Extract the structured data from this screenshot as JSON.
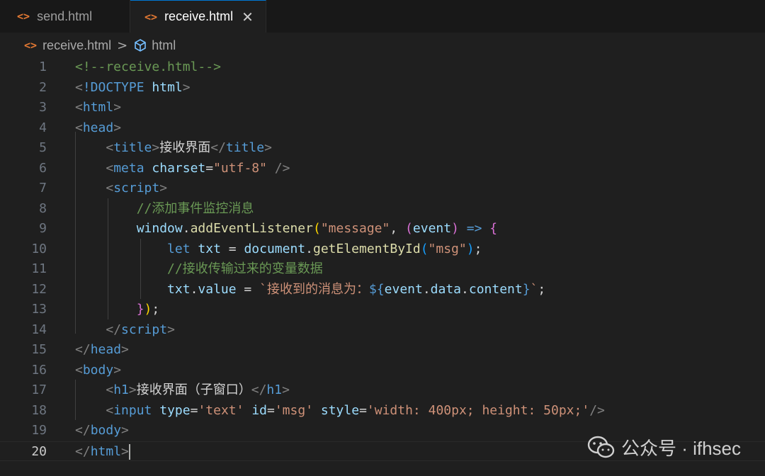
{
  "tabs": [
    {
      "label": "send.html",
      "icon": "html-file-icon"
    },
    {
      "label": "receive.html",
      "icon": "html-file-icon",
      "active": true
    }
  ],
  "tab_icon_glyph": "<>",
  "breadcrumb": {
    "file": "receive.html",
    "separator": ">",
    "symbol": "html"
  },
  "lines": [
    {
      "n": "1",
      "tokens": [
        [
          "c-cm",
          "<!--receive.html-->"
        ]
      ]
    },
    {
      "n": "2",
      "tokens": [
        [
          "c-br",
          "<"
        ],
        [
          "c-tag",
          "!DOCTYPE "
        ],
        [
          "c-attr",
          "html"
        ],
        [
          "c-br",
          ">"
        ]
      ]
    },
    {
      "n": "3",
      "tokens": [
        [
          "c-br",
          "<"
        ],
        [
          "c-tag",
          "html"
        ],
        [
          "c-br",
          ">"
        ]
      ]
    },
    {
      "n": "4",
      "tokens": [
        [
          "c-br",
          "<"
        ],
        [
          "c-tag",
          "head"
        ],
        [
          "c-br",
          ">"
        ]
      ]
    },
    {
      "n": "5",
      "tokens": [
        [
          "c-txt",
          "    "
        ],
        [
          "c-br",
          "<"
        ],
        [
          "c-tag",
          "title"
        ],
        [
          "c-br",
          ">"
        ],
        [
          "c-txt",
          "接收界面"
        ],
        [
          "c-br",
          "</"
        ],
        [
          "c-tag",
          "title"
        ],
        [
          "c-br",
          ">"
        ]
      ]
    },
    {
      "n": "6",
      "tokens": [
        [
          "c-txt",
          "    "
        ],
        [
          "c-br",
          "<"
        ],
        [
          "c-tag",
          "meta "
        ],
        [
          "c-attr",
          "charset"
        ],
        [
          "c-txt",
          "="
        ],
        [
          "c-str",
          "\"utf-8\""
        ],
        [
          "c-br",
          " />"
        ]
      ]
    },
    {
      "n": "7",
      "tokens": [
        [
          "c-txt",
          "    "
        ],
        [
          "c-br",
          "<"
        ],
        [
          "c-tag",
          "script"
        ],
        [
          "c-br",
          ">"
        ]
      ]
    },
    {
      "n": "8",
      "tokens": [
        [
          "c-txt",
          "        "
        ],
        [
          "c-cm",
          "//添加事件监控消息"
        ]
      ]
    },
    {
      "n": "9",
      "tokens": [
        [
          "c-txt",
          "        "
        ],
        [
          "c-var",
          "window"
        ],
        [
          "c-txt",
          "."
        ],
        [
          "c-fn",
          "addEventListener"
        ],
        [
          "c-b1",
          "("
        ],
        [
          "c-str",
          "\"message\""
        ],
        [
          "c-txt",
          ", "
        ],
        [
          "c-b2",
          "("
        ],
        [
          "c-var",
          "event"
        ],
        [
          "c-b2",
          ")"
        ],
        [
          "c-txt",
          " "
        ],
        [
          "c-kw",
          "=>"
        ],
        [
          "c-txt",
          " "
        ],
        [
          "c-b2",
          "{"
        ]
      ]
    },
    {
      "n": "10",
      "tokens": [
        [
          "c-txt",
          "            "
        ],
        [
          "c-kw",
          "let "
        ],
        [
          "c-var",
          "txt"
        ],
        [
          "c-txt",
          " = "
        ],
        [
          "c-var",
          "document"
        ],
        [
          "c-txt",
          "."
        ],
        [
          "c-fn",
          "getElementById"
        ],
        [
          "c-b3",
          "("
        ],
        [
          "c-str",
          "\"msg\""
        ],
        [
          "c-b3",
          ")"
        ],
        [
          "c-txt",
          ";"
        ]
      ]
    },
    {
      "n": "11",
      "tokens": [
        [
          "c-txt",
          "            "
        ],
        [
          "c-cm",
          "//接收传输过来的变量数据"
        ]
      ]
    },
    {
      "n": "12",
      "tokens": [
        [
          "c-txt",
          "            "
        ],
        [
          "c-var",
          "txt"
        ],
        [
          "c-txt",
          "."
        ],
        [
          "c-var",
          "value"
        ],
        [
          "c-txt",
          " = "
        ],
        [
          "c-str",
          "`接收到的消息为："
        ],
        [
          "c-tmp",
          "${"
        ],
        [
          "c-var",
          "event"
        ],
        [
          "c-txt",
          "."
        ],
        [
          "c-var",
          "data"
        ],
        [
          "c-txt",
          "."
        ],
        [
          "c-var",
          "content"
        ],
        [
          "c-tmp",
          "}"
        ],
        [
          "c-str",
          "`"
        ],
        [
          "c-txt",
          ";"
        ]
      ]
    },
    {
      "n": "13",
      "tokens": [
        [
          "c-txt",
          "        "
        ],
        [
          "c-b2",
          "}"
        ],
        [
          "c-b1",
          ")"
        ],
        [
          "c-txt",
          ";"
        ]
      ]
    },
    {
      "n": "14",
      "tokens": [
        [
          "c-txt",
          "    "
        ],
        [
          "c-br",
          "</"
        ],
        [
          "c-tag",
          "script"
        ],
        [
          "c-br",
          ">"
        ]
      ]
    },
    {
      "n": "15",
      "tokens": [
        [
          "c-br",
          "</"
        ],
        [
          "c-tag",
          "head"
        ],
        [
          "c-br",
          ">"
        ]
      ]
    },
    {
      "n": "16",
      "tokens": [
        [
          "c-br",
          "<"
        ],
        [
          "c-tag",
          "body"
        ],
        [
          "c-br",
          ">"
        ]
      ]
    },
    {
      "n": "17",
      "tokens": [
        [
          "c-txt",
          "    "
        ],
        [
          "c-br",
          "<"
        ],
        [
          "c-tag",
          "h1"
        ],
        [
          "c-br",
          ">"
        ],
        [
          "c-txt",
          "接收界面（子窗口）"
        ],
        [
          "c-br",
          "</"
        ],
        [
          "c-tag",
          "h1"
        ],
        [
          "c-br",
          ">"
        ]
      ]
    },
    {
      "n": "18",
      "tokens": [
        [
          "c-txt",
          "    "
        ],
        [
          "c-br",
          "<"
        ],
        [
          "c-tag",
          "input "
        ],
        [
          "c-attr",
          "type"
        ],
        [
          "c-txt",
          "="
        ],
        [
          "c-str",
          "'text'"
        ],
        [
          "c-txt",
          " "
        ],
        [
          "c-attr",
          "id"
        ],
        [
          "c-txt",
          "="
        ],
        [
          "c-str",
          "'msg'"
        ],
        [
          "c-txt",
          " "
        ],
        [
          "c-attr",
          "style"
        ],
        [
          "c-txt",
          "="
        ],
        [
          "c-str",
          "'width: 400px; height: 50px;'"
        ],
        [
          "c-br",
          "/>"
        ]
      ]
    },
    {
      "n": "19",
      "tokens": [
        [
          "c-br",
          "</"
        ],
        [
          "c-tag",
          "body"
        ],
        [
          "c-br",
          ">"
        ]
      ]
    },
    {
      "n": "20",
      "tokens": [
        [
          "c-br",
          "</"
        ],
        [
          "c-tag",
          "html"
        ],
        [
          "c-br",
          ">"
        ]
      ],
      "current": true
    }
  ],
  "watermark": {
    "text": "公众号 · ifhsec",
    "icon": "wechat-icon"
  }
}
